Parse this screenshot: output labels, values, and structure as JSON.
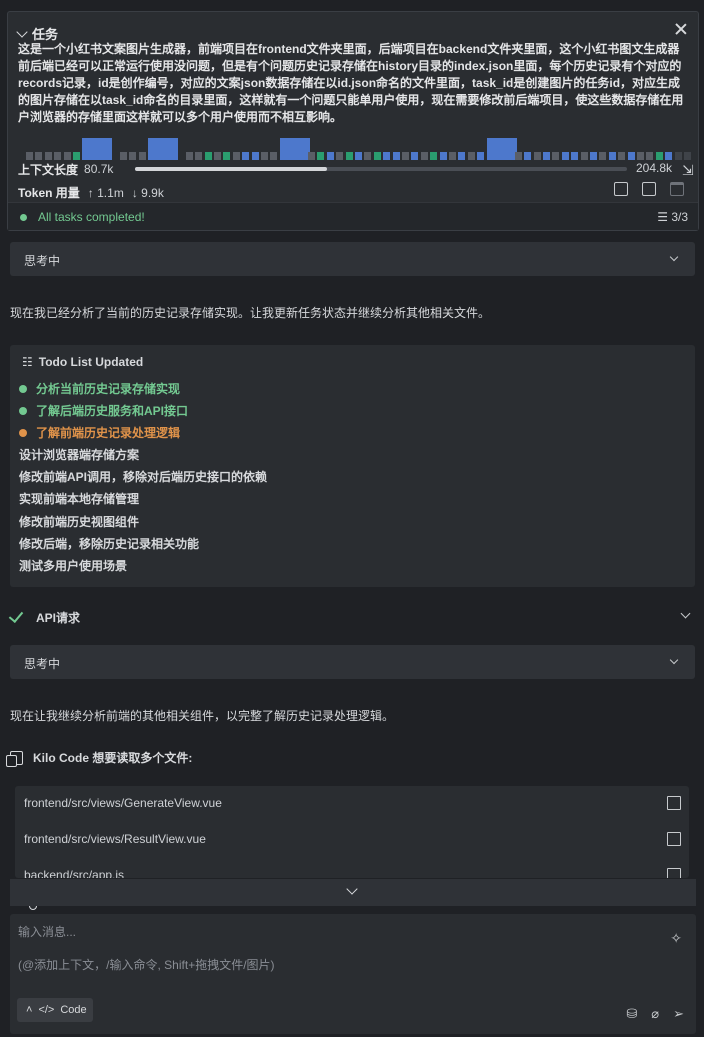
{
  "task": {
    "title": "任务",
    "description": "这是一个小红书文案图片生成器，前端项目在frontend文件夹里面，后端项目在backend文件夹里面，这个小红书图文生成器前后端已经可以正常运行使用没问题，但是有个问题历史记录存储在history目录的index.json里面，每个历史记录有个对应的records记录，id是创作编号，对应的文案json数据存储在以id.json命名的文件里面，task_id是创建图片的任务id，对应生成的图片存储在以task_id命名的目录里面，这样就有一个问题只能单用户使用，现在需要修改前后端项目，使这些数据存储在用户浏览器的存储里面这样就可以多个用户使用而不相互影响。",
    "context_label": "上下文长度",
    "context_used": "80.7k",
    "context_max": "204.8k",
    "context_fraction": 0.39,
    "token_label": "Token 用量",
    "tokens_up": "↑ 1.1m",
    "tokens_down": "↓ 9.9k",
    "status_text": "All tasks completed!",
    "status_count": "3/3"
  },
  "thinking_label": "思考中",
  "paragraph_1": "现在我已经分析了当前的历史记录存储实现。让我更新任务状态并继续分析其他相关文件。",
  "todo": {
    "title": "Todo List Updated",
    "items": [
      {
        "label": "分析当前历史记录存储实现",
        "status": "done"
      },
      {
        "label": "了解后端历史服务和API接口",
        "status": "done"
      },
      {
        "label": "了解前端历史记录处理逻辑",
        "status": "in_progress"
      },
      {
        "label": "设计浏览器端存储方案",
        "status": "pending"
      },
      {
        "label": "修改前端API调用，移除对后端历史接口的依赖",
        "status": "pending"
      },
      {
        "label": "实现前端本地存储管理",
        "status": "pending"
      },
      {
        "label": "修改前端历史视图组件",
        "status": "pending"
      },
      {
        "label": "修改后端，移除历史记录相关功能",
        "status": "pending"
      },
      {
        "label": "测试多用户使用场景",
        "status": "pending"
      }
    ]
  },
  "api_label": "API请求",
  "paragraph_2": "现在让我继续分析前端的其他相关组件，以完整了解历史记录处理逻辑。",
  "files": {
    "title": "Kilo Code 想要读取多个文件:",
    "items": [
      "frontend/src/views/GenerateView.vue",
      "frontend/src/views/ResultView.vue",
      "backend/src/app.js"
    ]
  },
  "input": {
    "placeholder": "输入消息...",
    "hint": "(@添加上下文，/输入命令, Shift+拖拽文件/图片)",
    "mode": "Code"
  },
  "colors": {
    "done": "#73c991",
    "in_progress": "#e0934a",
    "accent_blue": "#4d78cc"
  }
}
